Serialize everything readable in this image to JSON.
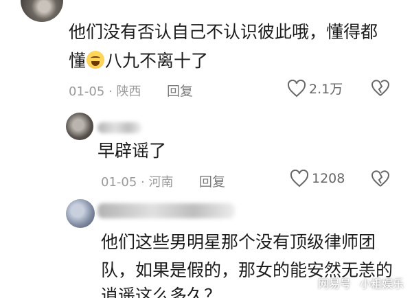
{
  "comments": [
    {
      "text_line1": "他们没有否认自己不认识彼此哦，懂得都",
      "text_line2_prefix": "懂",
      "text_line2_suffix": "八九不离十了",
      "emoji": "laughing-crying-emoji",
      "date_location": "01-05 · 陕西",
      "reply_label": "回复",
      "likes": "2.1万"
    },
    {
      "text_line1": "早辟谣了",
      "date_location": "01-05 · 河南",
      "reply_label": "回复",
      "likes": "1208"
    },
    {
      "text_line1": "他们这些男明星那个没有顶级律师团",
      "text_line2": "队，如果是假的，那女的能安然无恙的",
      "text_line3": "逍遥这么多久？"
    }
  ],
  "watermark": {
    "brand": "网易号",
    "account": "小粗娱乐"
  },
  "colors": {
    "text": "#1c1c1c",
    "meta": "#9a9a9a",
    "icon": "#666666"
  }
}
